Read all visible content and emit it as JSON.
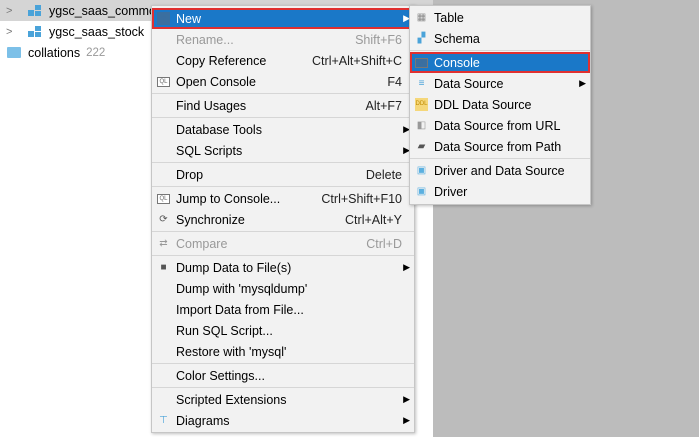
{
  "tree": [
    {
      "label": "ygsc_saas_commodity",
      "display": "ygsc_saas_commo",
      "icon": "schema-icon",
      "selected": true
    },
    {
      "label": "ygsc_saas_stock",
      "icon": "schema-icon"
    },
    {
      "label": "collations",
      "count": "222",
      "icon": "folder-icon"
    }
  ],
  "menu": [
    {
      "label": "New",
      "icon": "plus-icon",
      "highlighted": true,
      "submenu": true
    },
    {
      "label": "Rename...",
      "shortcut": "Shift+F6",
      "disabled": true
    },
    {
      "label": "Copy Reference",
      "shortcut": "Ctrl+Alt+Shift+C"
    },
    {
      "label": "Open Console",
      "shortcut": "F4",
      "icon": "console-icon"
    },
    {
      "sep": true
    },
    {
      "label": "Find Usages",
      "shortcut": "Alt+F7"
    },
    {
      "sep": true
    },
    {
      "label": "Database Tools",
      "submenu": true
    },
    {
      "label": "SQL Scripts",
      "submenu": true
    },
    {
      "sep": true
    },
    {
      "label": "Drop",
      "shortcut": "Delete"
    },
    {
      "sep": true
    },
    {
      "label": "Jump to Console...",
      "shortcut": "Ctrl+Shift+F10",
      "icon": "console-icon"
    },
    {
      "label": "Synchronize",
      "shortcut": "Ctrl+Alt+Y",
      "icon": "sync-icon"
    },
    {
      "sep": true
    },
    {
      "label": "Compare",
      "shortcut": "Ctrl+D",
      "disabled": true,
      "icon": "compare-icon"
    },
    {
      "sep": true
    },
    {
      "label": "Dump Data to File(s)",
      "submenu": true,
      "icon": "save-icon"
    },
    {
      "label": "Dump with 'mysqldump'"
    },
    {
      "label": "Import Data from File..."
    },
    {
      "label": "Run SQL Script..."
    },
    {
      "label": "Restore with 'mysql'"
    },
    {
      "sep": true
    },
    {
      "label": "Color Settings..."
    },
    {
      "sep": true
    },
    {
      "label": "Scripted Extensions",
      "submenu": true
    },
    {
      "label": "Diagrams",
      "submenu": true,
      "icon": "diagram-icon"
    }
  ],
  "submenu": [
    {
      "label": "Table",
      "icon": "table-icon"
    },
    {
      "label": "Schema",
      "icon": "schema-icon"
    },
    {
      "sep": true
    },
    {
      "label": "Console",
      "icon": "console-icon",
      "highlighted": true
    },
    {
      "label": "Data Source",
      "icon": "datasource-icon",
      "submenu": true
    },
    {
      "label": "DDL Data Source",
      "icon": "ddl-icon"
    },
    {
      "label": "Data Source from URL",
      "icon": "url-icon"
    },
    {
      "label": "Data Source from Path",
      "icon": "folder-open-icon"
    },
    {
      "sep": true
    },
    {
      "label": "Driver and Data Source",
      "icon": "driver-icon"
    },
    {
      "label": "Driver",
      "icon": "driver-icon"
    }
  ]
}
